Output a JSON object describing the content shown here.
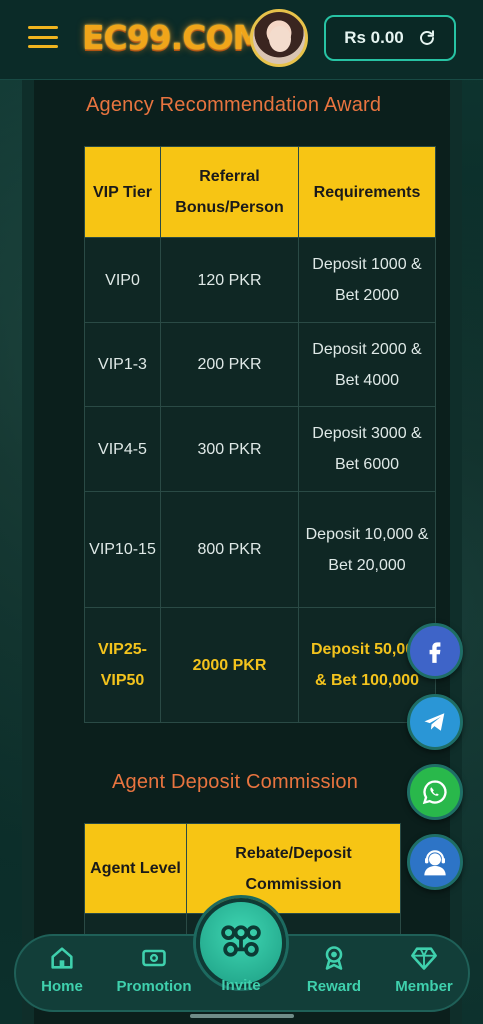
{
  "header": {
    "logo_text": "EC99.COM",
    "balance": "Rs 0.00"
  },
  "award": {
    "title": "Agency Recommendation Award",
    "columns": [
      "VIP Tier",
      "Referral Bonus/Person",
      "Requirements"
    ],
    "rows": [
      {
        "tier": "VIP0",
        "bonus": "120 PKR",
        "req": "Deposit 1000 & Bet 2000"
      },
      {
        "tier": "VIP1-3",
        "bonus": "200 PKR",
        "req": "Deposit 2000 & Bet 4000"
      },
      {
        "tier": "VIP4-5",
        "bonus": "300 PKR",
        "req": "Deposit 3000 & Bet 6000"
      },
      {
        "tier": "VIP10-15",
        "bonus": "800 PKR",
        "req": "Deposit 10,000 & Bet 20,000"
      },
      {
        "tier": "VIP25-VIP50",
        "bonus": "2000 PKR",
        "req": "Deposit 50,000 & Bet 100,000"
      }
    ]
  },
  "commission": {
    "title": "Agent Deposit Commission",
    "columns": [
      "Agent Level",
      "Rebate/Deposit Commission"
    ]
  },
  "social": {
    "icons": [
      "facebook-icon",
      "telegram-icon",
      "whatsapp-icon",
      "customer-service-icon"
    ],
    "colors": {
      "facebook": "#3e64c8",
      "telegram": "#2a96d6",
      "whatsapp": "#29b84b",
      "support": "#2d74c6"
    }
  },
  "nav": {
    "home": "Home",
    "promotion": "Promotion",
    "invite": "Invite",
    "reward": "Reward",
    "member": "Member"
  },
  "colors": {
    "accent": "#f7c514",
    "title": "#e8743f",
    "nav_text": "#3fd0ad"
  }
}
